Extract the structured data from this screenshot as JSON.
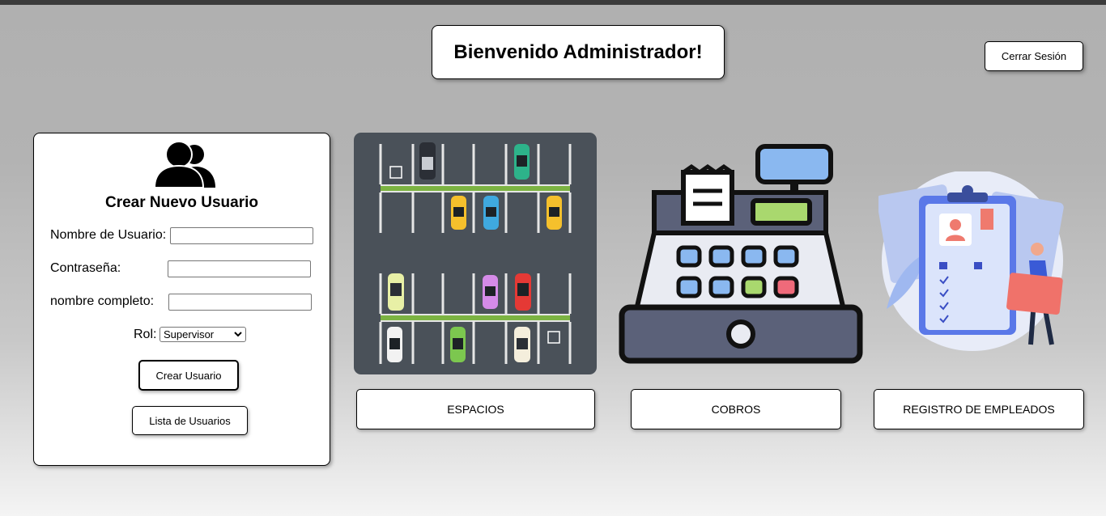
{
  "header": {
    "title": "Bienvenido Administrador!",
    "logout_label": "Cerrar Sesión"
  },
  "create_user": {
    "heading": "Crear Nuevo Usuario",
    "username_label": "Nombre de Usuario:",
    "username_value": "",
    "password_label": "Contraseña:",
    "password_value": "",
    "fullname_label": "nombre completo:",
    "fullname_value": "",
    "role_label": "Rol:",
    "role_selected": "Supervisor",
    "create_button": "Crear Usuario",
    "list_button": "Lista de Usuarios"
  },
  "modules": [
    {
      "label": "ESPACIOS",
      "icon": "parking-lot-image"
    },
    {
      "label": "COBROS",
      "icon": "cash-register-image"
    },
    {
      "label": "REGISTRO DE EMPLEADOS",
      "icon": "employee-registry-image"
    }
  ]
}
